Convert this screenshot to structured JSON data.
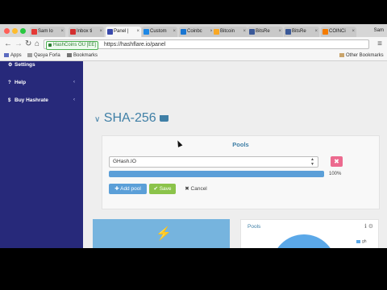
{
  "browser": {
    "tabs": [
      {
        "label": "Sam lo",
        "color": "#e53935"
      },
      {
        "label": "Inbox ti",
        "color": "#d32f2f"
      },
      {
        "label": "Panel |",
        "color": "#3949ab",
        "active": true
      },
      {
        "label": "Custom",
        "color": "#1e88e5"
      },
      {
        "label": "Coinbc",
        "color": "#1976d2"
      },
      {
        "label": "Bitcoin",
        "color": "#f9a825"
      },
      {
        "label": "BitsRe",
        "color": "#3b5998"
      },
      {
        "label": "BitsRe",
        "color": "#3b5998"
      },
      {
        "label": "COINCi",
        "color": "#f57c00"
      }
    ],
    "profile": "Sam",
    "secure_label": "HashCoins OU [EE]",
    "url": "https://hashflare.io/panel",
    "bookmarks": {
      "apps": "Apps",
      "items": [
        "Qasya Forla",
        "Bookmarks"
      ],
      "other": "Other Bookmarks"
    }
  },
  "sidebar": {
    "items": [
      {
        "label": "Settings",
        "icon": "gears-icon"
      },
      {
        "label": "Help",
        "icon": "question-icon"
      },
      {
        "label": "Buy Hashrate",
        "icon": "dollar-icon"
      }
    ]
  },
  "section": {
    "title": "SHA-256",
    "collapse_icon": "chevron-down-icon",
    "cart_icon": "cart-icon"
  },
  "pools_card": {
    "title": "Pools",
    "selected_pool": "GHash.IO",
    "progress_percent": 100,
    "progress_label": "100%",
    "add_label": "Add pool",
    "save_label": "Save",
    "cancel_label": "Cancel"
  },
  "pools_chart": {
    "title": "Pools",
    "legend_label": "gh",
    "color": "#5ba8e8"
  }
}
